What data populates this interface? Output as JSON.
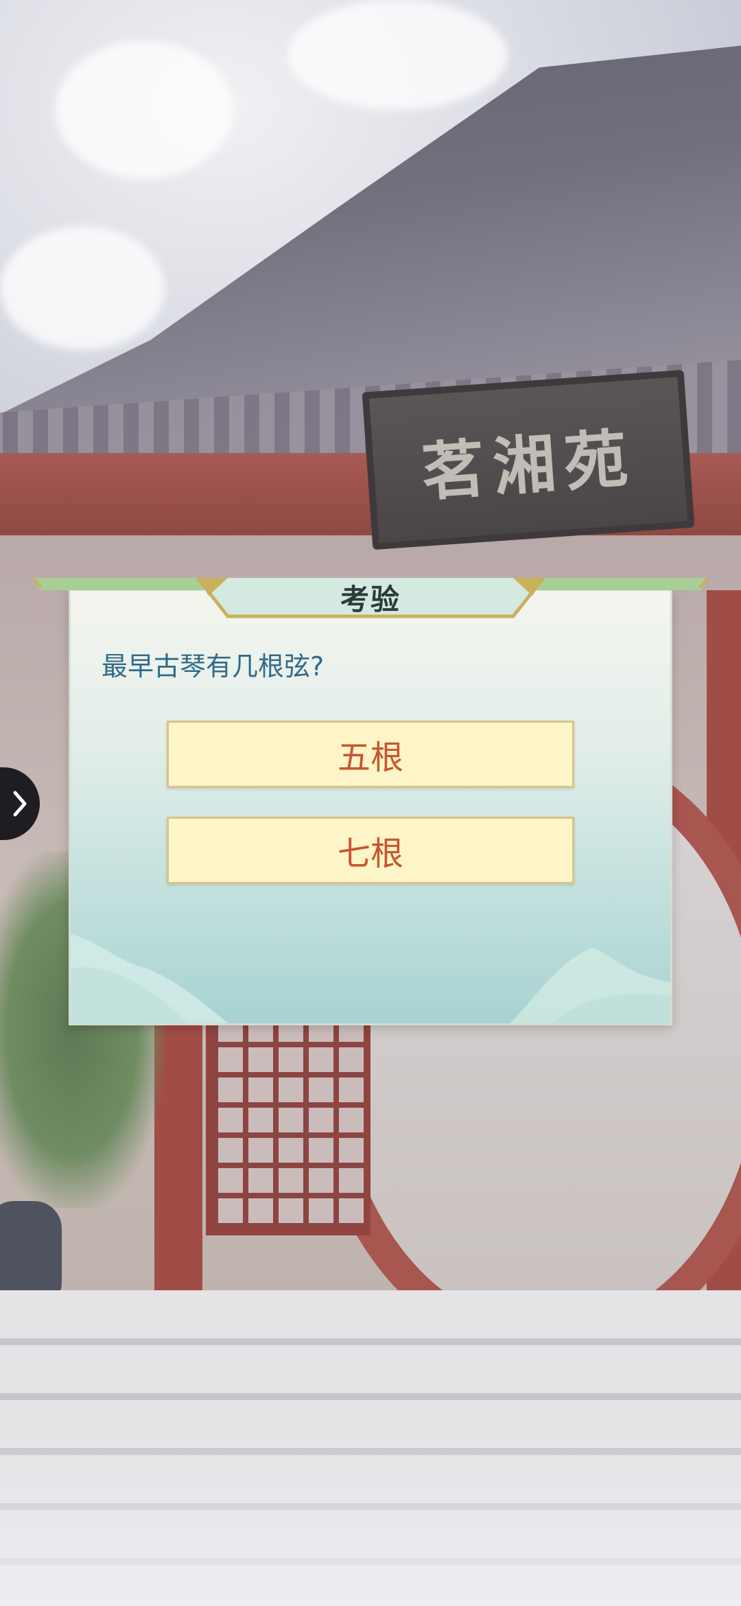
{
  "scene": {
    "plaque_text": "茗湘苑"
  },
  "dialog": {
    "title": "考验",
    "question": "最早古琴有几根弦?",
    "answers": [
      {
        "label": "五根"
      },
      {
        "label": "七根"
      }
    ]
  },
  "side_tab": {
    "icon": "chevron-right-icon"
  },
  "colors": {
    "answer_bg": "#fdf4c7",
    "answer_text": "#c8552f",
    "question_text": "#2f6a8a",
    "title_trim": "#c9b05a",
    "title_band": "#a8cf96"
  }
}
